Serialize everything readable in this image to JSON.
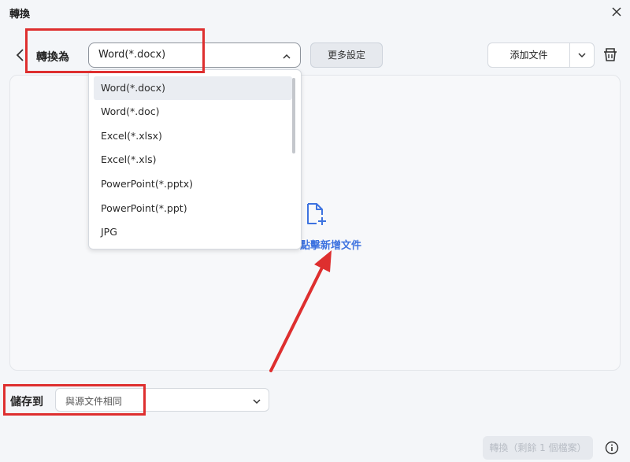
{
  "window": {
    "title": "轉換"
  },
  "header": {
    "convert_to_label": "轉換為",
    "format_select": {
      "value": "Word(*.docx)"
    },
    "more_settings_label": "更多設定",
    "add_file_label": "添加文件"
  },
  "format_menu": {
    "options": [
      "Word(*.docx)",
      "Word(*.doc)",
      "Excel(*.xlsx)",
      "Excel(*.xls)",
      "PowerPoint(*.pptx)",
      "PowerPoint(*.ppt)",
      "JPG"
    ],
    "selected": "Word(*.docx)"
  },
  "drop_area": {
    "prompt": "點擊新增文件",
    "accent_color": "#3e73e0"
  },
  "footer": {
    "save_to_label": "儲存到",
    "save_location_value": "與源文件相同",
    "convert_button_label": "轉換（剩餘 1 個檔案）"
  },
  "annotations": {
    "highlight_color": "#de2f2f"
  },
  "icons": [
    "close-icon",
    "back-arrow-icon",
    "chevron-up-icon",
    "chevron-down-icon",
    "trash-icon",
    "add-document-icon",
    "info-icon"
  ]
}
